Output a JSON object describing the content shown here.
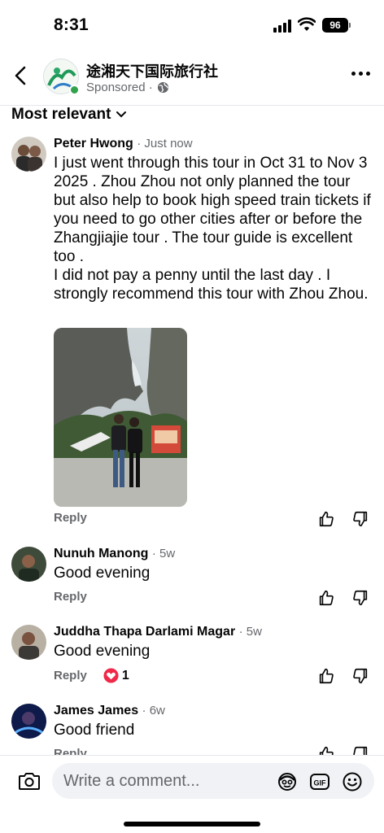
{
  "status_bar": {
    "time": "8:31",
    "battery": "96"
  },
  "header": {
    "page_name": "途湘天下国际旅行社",
    "sponsored": "Sponsored ·"
  },
  "sort": {
    "label": "Most relevant"
  },
  "comments": [
    {
      "name": "Peter Hwong",
      "time": "· Just now",
      "text": "I just went through this tour in Oct 31 to Nov 3  2025 . Zhou Zhou not only planned the tour but also help to book high speed train tickets if you need to go other cities after or before the Zhangjiajie tour . The tour guide is excellent too .\nI did not pay a penny until the last day . I strongly recommend this tour with Zhou Zhou.",
      "reply": "Reply"
    },
    {
      "name": "Nunuh Manong",
      "time": "· 5w",
      "text": "Good evening",
      "reply": "Reply"
    },
    {
      "name": "Juddha Thapa Darlami Magar",
      "time": "· 5w",
      "text": "Good evening",
      "reply": "Reply",
      "reaction_count": "1"
    },
    {
      "name": "James James",
      "time": "· 6w",
      "text": "Good friend",
      "reply": "Reply"
    }
  ],
  "composer": {
    "placeholder": "Write a comment..."
  },
  "icons": [
    "back-arrow-icon",
    "globe-icon",
    "more-icon",
    "chevron-down-icon",
    "like-icon",
    "dislike-icon",
    "heart-icon",
    "camera-icon",
    "avatar-sticker-icon",
    "gif-icon",
    "emoji-icon"
  ],
  "colors": {
    "heart": "#f02849",
    "online": "#31a24c",
    "secondary_text": "#65676b",
    "input_bg": "#f0f2f5"
  }
}
